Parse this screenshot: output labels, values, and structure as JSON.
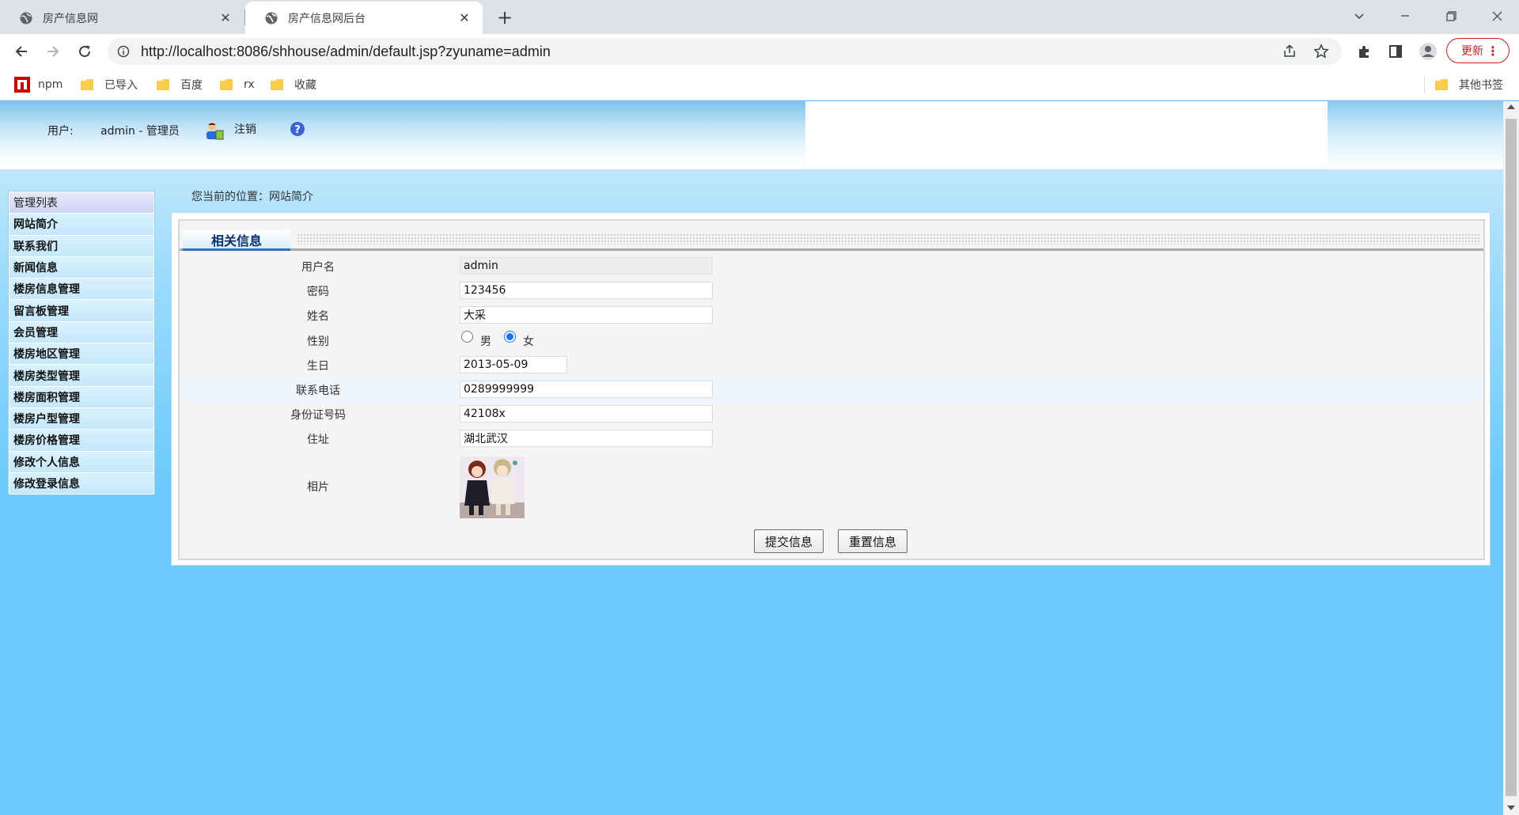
{
  "browser": {
    "tabs": [
      {
        "title": "房产信息网",
        "active": false
      },
      {
        "title": "房产信息网后台",
        "active": true
      }
    ],
    "url": "http://localhost:8086/shhouse/admin/default.jsp?zyuname=admin",
    "update_label": "更新",
    "bookmarks": [
      {
        "label": "npm",
        "icon": "npm-logo-icon"
      },
      {
        "label": "已导入",
        "icon": "folder-icon"
      },
      {
        "label": "百度",
        "icon": "folder-icon"
      },
      {
        "label": "rx",
        "icon": "folder-icon"
      },
      {
        "label": "收藏",
        "icon": "folder-icon"
      }
    ],
    "other_bookmarks": "其他书签"
  },
  "header": {
    "user_label": "用户:",
    "user_value": "admin - 管理员",
    "logout_label": "注销"
  },
  "sidebar": {
    "title": "管理列表",
    "items": [
      "网站简介",
      "联系我们",
      "新闻信息",
      "楼房信息管理",
      "留言板管理",
      "会员管理",
      "楼房地区管理",
      "楼房类型管理",
      "楼房面积管理",
      "楼房户型管理",
      "楼房价格管理",
      "修改个人信息",
      "修改登录信息"
    ]
  },
  "breadcrumb": "您当前的位置：网站简介",
  "panel": {
    "title": "相关信息"
  },
  "form": {
    "username": {
      "label": "用户名",
      "value": "admin"
    },
    "password": {
      "label": "密码",
      "value": "123456"
    },
    "name": {
      "label": "姓名",
      "value": "大采"
    },
    "gender": {
      "label": "性别",
      "options": [
        "男",
        "女"
      ],
      "selected": "女"
    },
    "birthday": {
      "label": "生日",
      "value": "2013-05-09"
    },
    "phone": {
      "label": "联系电话",
      "value": "0289999999"
    },
    "id_number": {
      "label": "身份证号码",
      "value": "42108x"
    },
    "address": {
      "label": "住址",
      "value": "湖北武汉"
    },
    "photo": {
      "label": "相片"
    },
    "submit_label": "提交信息",
    "reset_label": "重置信息"
  },
  "colors": {
    "page_background": "#6ccafc",
    "update_accent": "#c5221f",
    "radio_accent": "#1a73e8"
  }
}
